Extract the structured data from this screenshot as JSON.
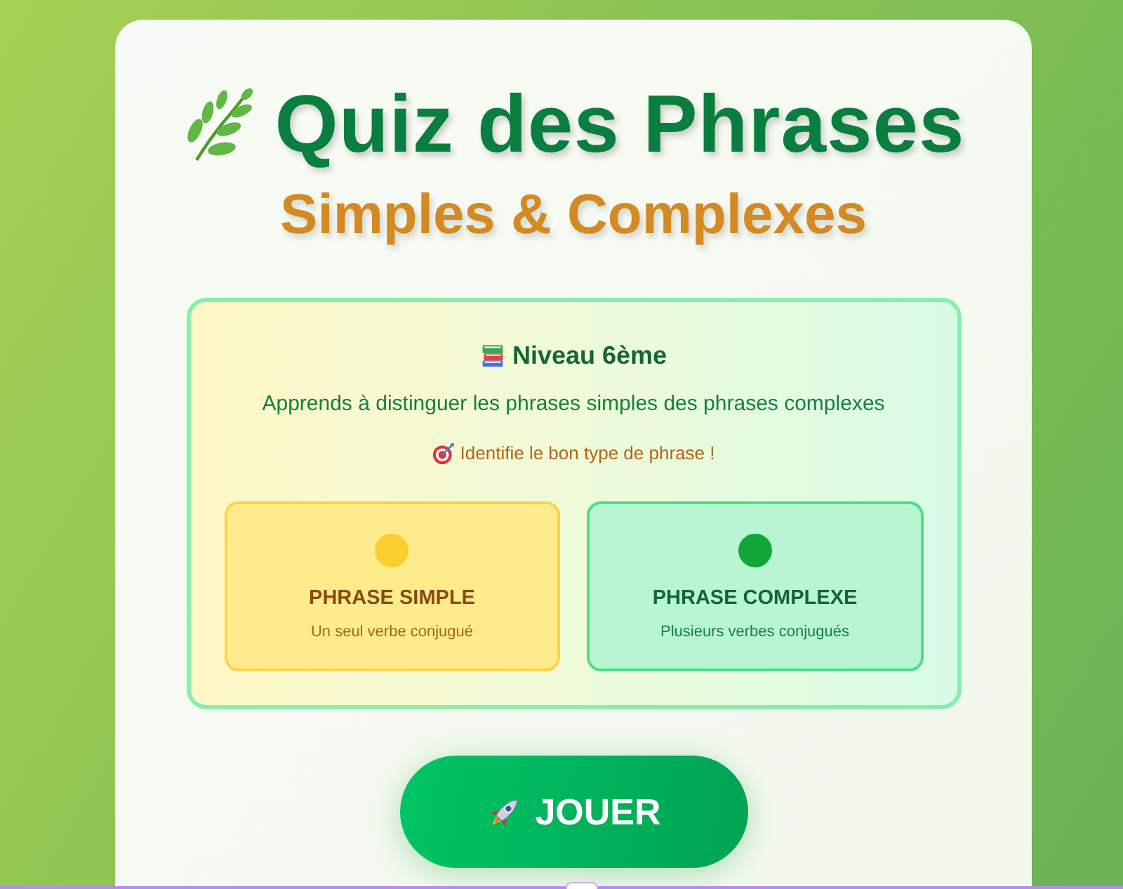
{
  "title": "Quiz des Phrases",
  "subtitle": "Simples & Complexes",
  "intro": {
    "heading": "Niveau 6ème",
    "description": "Apprends à distinguer les phrases simples des phrases complexes",
    "goal": "Identifie le bon type de phrase !"
  },
  "sentence_types": [
    {
      "kind": "simple",
      "color": "#fbcd2d",
      "title": "PHRASE SIMPLE",
      "description": "Un seul verbe conjugué"
    },
    {
      "kind": "complex",
      "color": "#13a538",
      "title": "PHRASE COMPLEXE",
      "description": "Plusieurs verbes conjugués"
    }
  ],
  "play_button": {
    "label": "JOUER"
  }
}
